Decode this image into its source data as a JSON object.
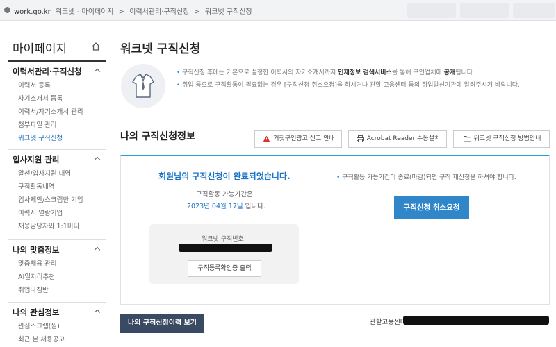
{
  "browser": {
    "domain": "work.go.kr",
    "breadcrumb": [
      "워크넷 - 마이페이지",
      ">",
      "이력서관리·구직신청",
      ">",
      "워크넷 구직신청"
    ]
  },
  "sidebar": {
    "title": "마이페이지",
    "groups": [
      {
        "title": "이력서관리·구직신청",
        "items": [
          "이력서 등록",
          "자기소개서 등록",
          "이력서/자기소개서 관리",
          "첨부파일 관리",
          "워크넷 구직신청"
        ],
        "active_index": 4
      },
      {
        "title": "입사지원 관리",
        "items": [
          "알선/입사지원 내역",
          "구직활동내역",
          "입사제안/스크랩한 기업",
          "이력서 열람기업",
          "채용담당자와 1:1미디"
        ]
      },
      {
        "title": "나의 맞춤정보",
        "items": [
          "맞춤채용 관리",
          "AI일자리추천",
          "취업나침반"
        ]
      },
      {
        "title": "나의 관심정보",
        "items": [
          "관심스크랩(찜)",
          "최근 본 채용공고"
        ]
      }
    ]
  },
  "main": {
    "title": "워크넷 구직신청",
    "notice": {
      "line1_pre": "구직신청 후에는 기본으로 설정한 이력서의 자기소개서까지 ",
      "line1_bold1": "인재정보 검색서비스",
      "line1_mid": "를 통해 구인업체에 ",
      "line1_bold2": "공개",
      "line1_post": "됩니다.",
      "line2": "취업 등으로 구직활동이 필요없는 경우 [구직신청 취소요청]을 하시거나 관할 고용센터 등의 취업알선기관에 알려주시기 바랍니다."
    },
    "section_title": "나의 구직신청정보",
    "buttons": {
      "fake_report": "거짓구인광고 신고 안내",
      "acrobat": "Acrobat Reader 수동설치",
      "howto": "워크넷 구직신청 방법안내"
    },
    "status": {
      "complete_msg": "회원님의 구직신청이 완료되었습니다.",
      "period_label": "구직활동 가능기간은",
      "period_date": "2023년 04월 17일",
      "period_suffix": " 입니다.",
      "number_label": "워크넷 구직번호",
      "cert_button": "구직등록확인증 출력",
      "reapply_note": "구직활동 가능기간이 종료(마감)되면 구직 재신청을 하셔야 합니다.",
      "cancel_button": "구직신청 취소요청"
    },
    "history_button": "나의 구직신청이력 보기",
    "office_label": "관할고용센터"
  },
  "colors": {
    "accent_blue": "#2f86c9",
    "dark_navy": "#3b4a63",
    "active_link": "#1a6bb5"
  }
}
